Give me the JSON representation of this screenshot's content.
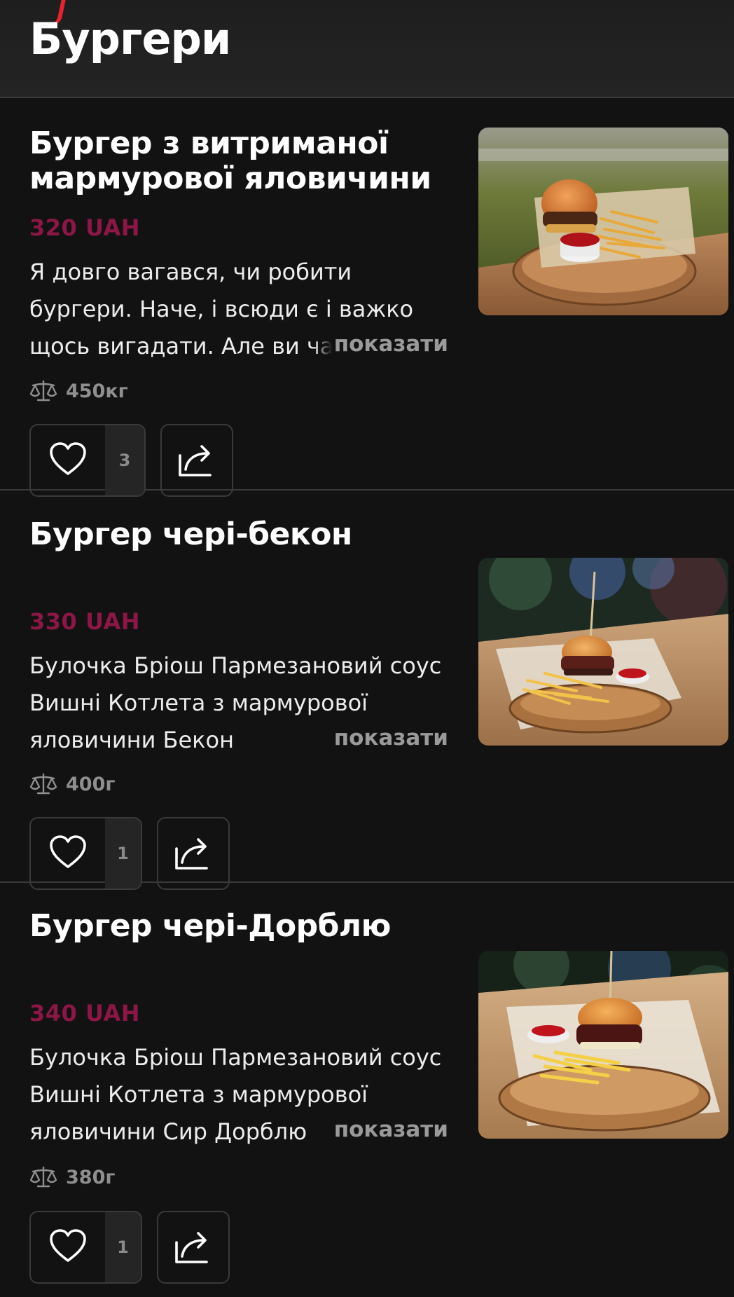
{
  "header": {
    "title": "Бургери"
  },
  "items": [
    {
      "title": "Бургер з витриманої мармурової яловичини",
      "price": "320 UAH",
      "description": "Я довго вагався, чи робити бургери. Наче, і всюди є і важко щось вигадати. Але ви часто запитували",
      "show_more": "показати",
      "weight": "450кг",
      "likes": "3",
      "icons": {
        "weight": "scale-icon",
        "like": "heart-icon",
        "share": "share-icon"
      }
    },
    {
      "title": "Бургер чері-бекон",
      "price": "330 UAH",
      "description": "Булочка Бріош Пармезановий соус Вишні Котлета з мармурової яловичини Бекон",
      "show_more": "показати",
      "weight": "400г",
      "likes": "1",
      "icons": {
        "weight": "scale-icon",
        "like": "heart-icon",
        "share": "share-icon"
      }
    },
    {
      "title": "Бургер чері-Дорблю",
      "price": "340 UAH",
      "description": "Булочка Бріош Пармезановий соус Вишні Котлета з мармурової яловичини Сир Дорблю",
      "show_more": "показати",
      "weight": "380г",
      "likes": "1",
      "icons": {
        "weight": "scale-icon",
        "like": "heart-icon",
        "share": "share-icon"
      }
    }
  ],
  "colors": {
    "background": "#121212",
    "header_background": "#232323",
    "price": "#8c1646",
    "accent": "#e8232f",
    "muted_text": "#9a9a9a",
    "border": "#3a3a3a"
  }
}
